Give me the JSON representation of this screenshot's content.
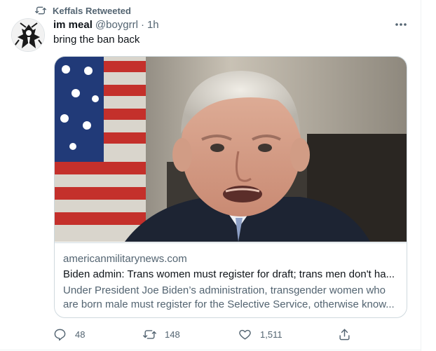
{
  "retweet_banner": {
    "text": "Keffals Retweeted"
  },
  "tweet": {
    "author_name": "im meal",
    "handle": "@boygrrl",
    "separator": "·",
    "time": "1h",
    "text": "bring the ban back"
  },
  "card": {
    "domain": "americanmilitarynews.com",
    "title": "Biden admin: Trans women must register for draft; trans men don't ha...",
    "description": "Under President Joe Biden’s administration, transgender women who are born male must register for the Selective Service, otherwise know..."
  },
  "actions": {
    "reply_count": "48",
    "retweet_count": "148",
    "like_count": "1,511"
  },
  "icons": {
    "retweet_banner": "retweet-icon",
    "more": "more-dots-icon",
    "reply": "reply-icon",
    "retweet": "retweet-icon",
    "like": "heart-icon",
    "share": "share-icon"
  },
  "colors": {
    "secondary_text": "#536471",
    "primary_text": "#0f1419",
    "border": "#cfd9de"
  }
}
